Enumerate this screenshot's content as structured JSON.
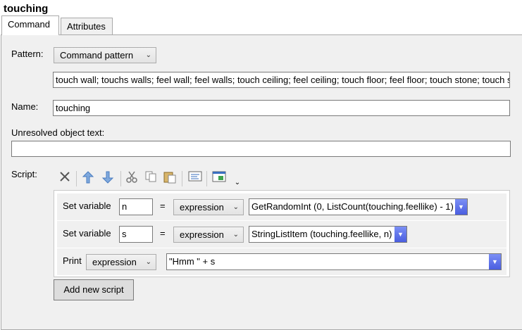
{
  "window": {
    "title": "touching"
  },
  "tabs": [
    {
      "label": "Command"
    },
    {
      "label": "Attributes"
    }
  ],
  "form": {
    "pattern_label": "Pattern:",
    "pattern_type": "Command pattern",
    "pattern_value": "touch wall; touchs walls; feel wall; feel walls; touch ceiling; feel ceiling; touch floor; feel floor; touch stone; touch s",
    "name_label": "Name:",
    "name_value": "touching",
    "unresolved_label": "Unresolved object text:",
    "unresolved_value": "",
    "script_label": "Script:"
  },
  "toolbar": {
    "icons": [
      "delete-icon",
      "move-up-icon",
      "move-down-icon",
      "cut-icon",
      "copy-icon",
      "paste-icon",
      "code-view-icon",
      "popout-icon",
      "more-icon"
    ]
  },
  "script": {
    "rows": [
      {
        "command": "Set variable",
        "var": "n",
        "eq": "=",
        "mode": "expression",
        "expr": "GetRandomInt (0, ListCount(touching.feellike) - 1)"
      },
      {
        "command": "Set variable",
        "var": "s",
        "eq": "=",
        "mode": "expression",
        "expr": "StringListItem (touching.feellike, n)"
      },
      {
        "command": "Print",
        "mode": "expression",
        "expr": "\"Hmm \" + s"
      }
    ],
    "add_button": "Add new script"
  },
  "colors": {
    "panel_bg": "#f0f0f0",
    "expr_button": "#5a6ee8"
  }
}
